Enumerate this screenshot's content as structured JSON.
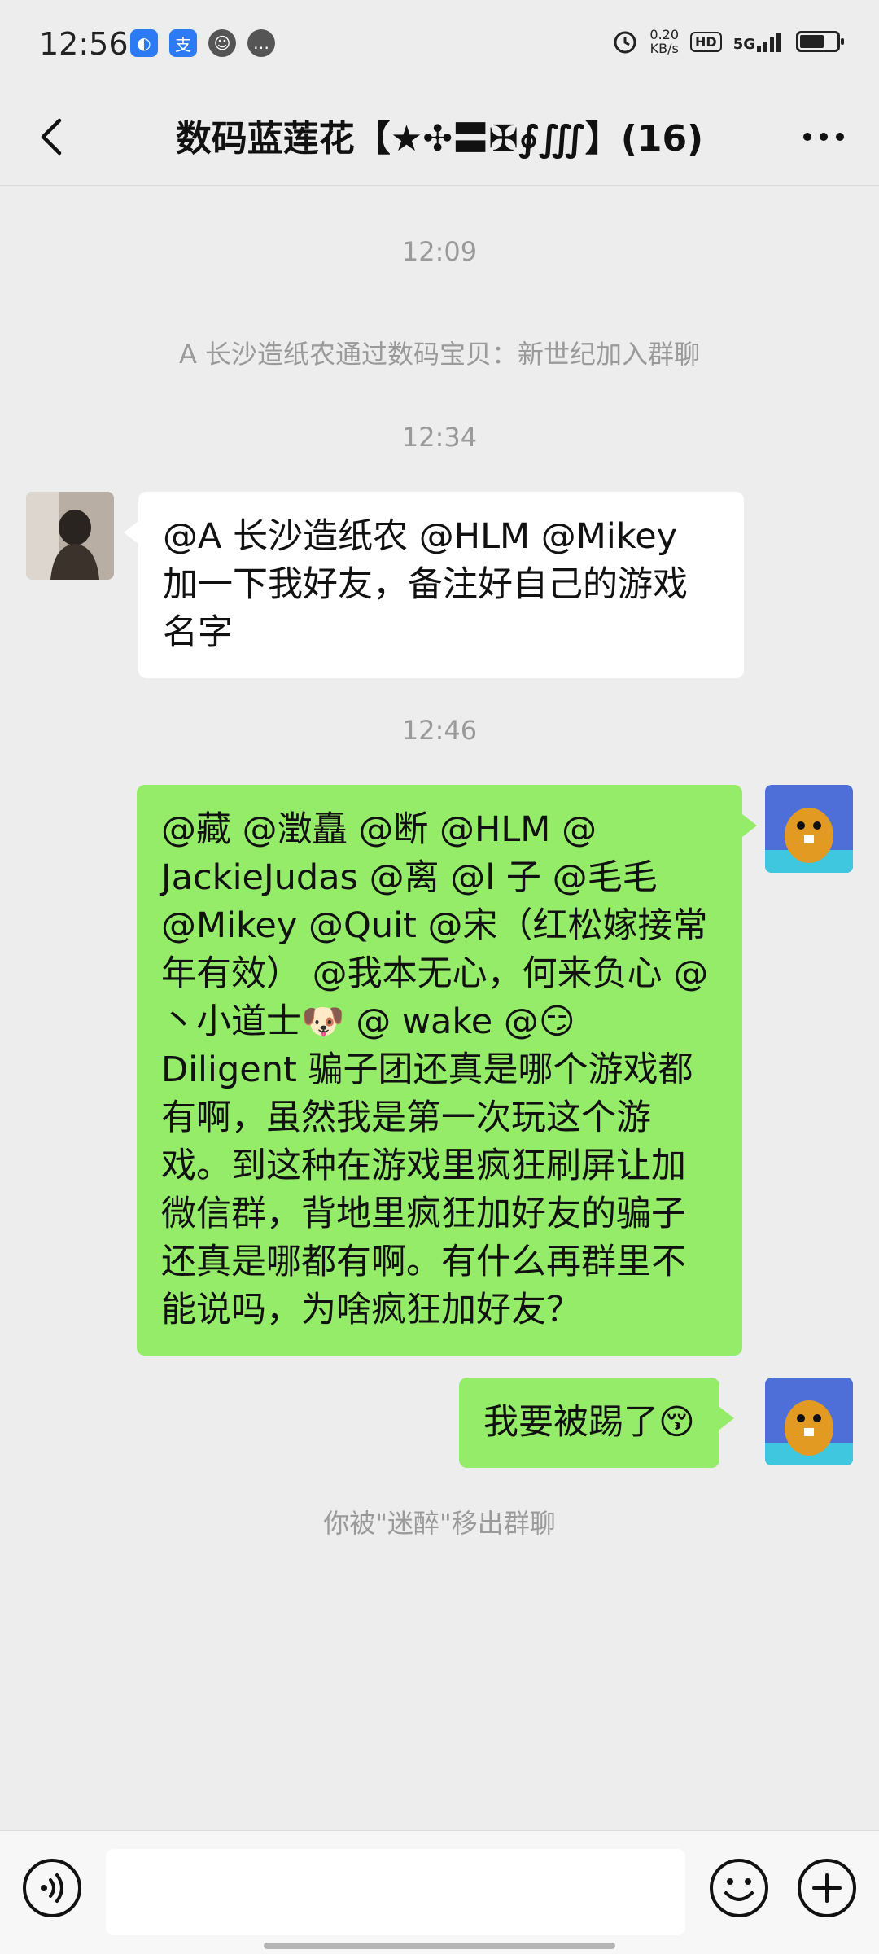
{
  "status_bar": {
    "time": "12:56",
    "speed_value": "0.20",
    "speed_unit": "KB/s",
    "hd_label": "HD",
    "network": "5G"
  },
  "header": {
    "title": "数码蓝莲花【★✣〓✠∮∭】(16)"
  },
  "messages": {
    "time_1": "12:09",
    "system_join": "A 长沙造纸农通过数码宝贝：新世纪加入群聊",
    "time_2": "12:34",
    "msg_1": "@A 长沙造纸农 @HLM @Mikey 加一下我好友，备注好自己的游戏名字",
    "time_3": "12:46",
    "msg_2": "@藏 @澂矗 @断 @HLM @ JackieJudas @离 @l 子 @毛毛 @Mikey @Quit @宋（红松嫁接常年有效） @我本无心，何来负心 @丶小道士🐶 @ wake @😏 Diligent 骗子团还真是哪个游戏都有啊，虽然我是第一次玩这个游戏。到这种在游戏里疯狂刷屏让加微信群，背地里疯狂加好友的骗子还真是哪都有啊。有什么再群里不能说吗，为啥疯狂加好友？",
    "msg_3": "我要被踢了😚",
    "system_removed": "你被\"迷醉\"移出群聊"
  },
  "colors": {
    "background": "#ededed",
    "bubble_sent": "#95ec69",
    "bubble_received": "#ffffff",
    "system_text": "#9a9a9a"
  },
  "icons": {
    "back": "chevron-left-icon",
    "more": "more-icon",
    "voice": "voice-icon",
    "emoji": "emoji-icon",
    "plus": "plus-icon"
  }
}
